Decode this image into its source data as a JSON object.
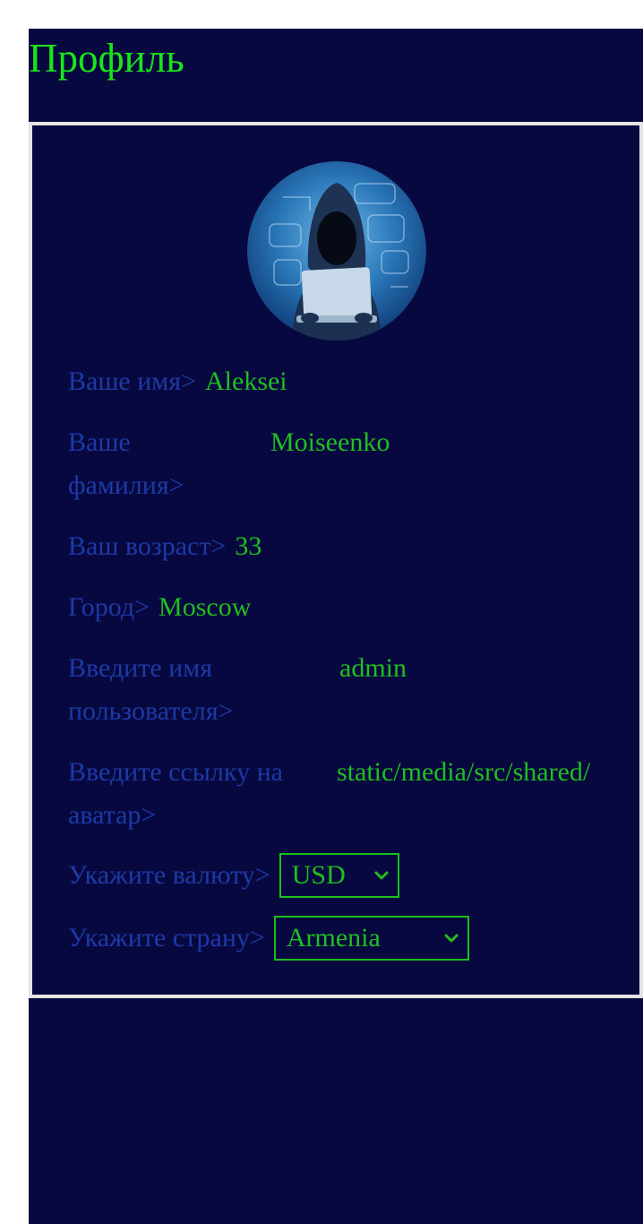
{
  "header": {
    "title": "Профиль"
  },
  "profile": {
    "avatar_icon": "hooded-hacker-avatar",
    "name": {
      "label": "Ваше имя>",
      "value": "Aleksei"
    },
    "surname": {
      "label": "Ваше фамилия>",
      "value": "Moiseenko"
    },
    "age": {
      "label": "Ваш возраст>",
      "value": "33"
    },
    "city": {
      "label": "Город>",
      "value": "Moscow"
    },
    "username": {
      "label": "Введите имя пользователя>",
      "value": "admin"
    },
    "avatar_url": {
      "label": "Введите ссылку на аватар>",
      "value": "static/media/src/shared/"
    },
    "currency": {
      "label": "Укажите валюту>",
      "selected": "USD"
    },
    "country": {
      "label": "Укажите страну>",
      "selected": "Armenia"
    }
  },
  "colors": {
    "background": "#080840",
    "accent_green": "#19e619",
    "value_green": "#1fbf1f",
    "label_blue": "#1c3aa6",
    "border": "#e4e4e4"
  }
}
